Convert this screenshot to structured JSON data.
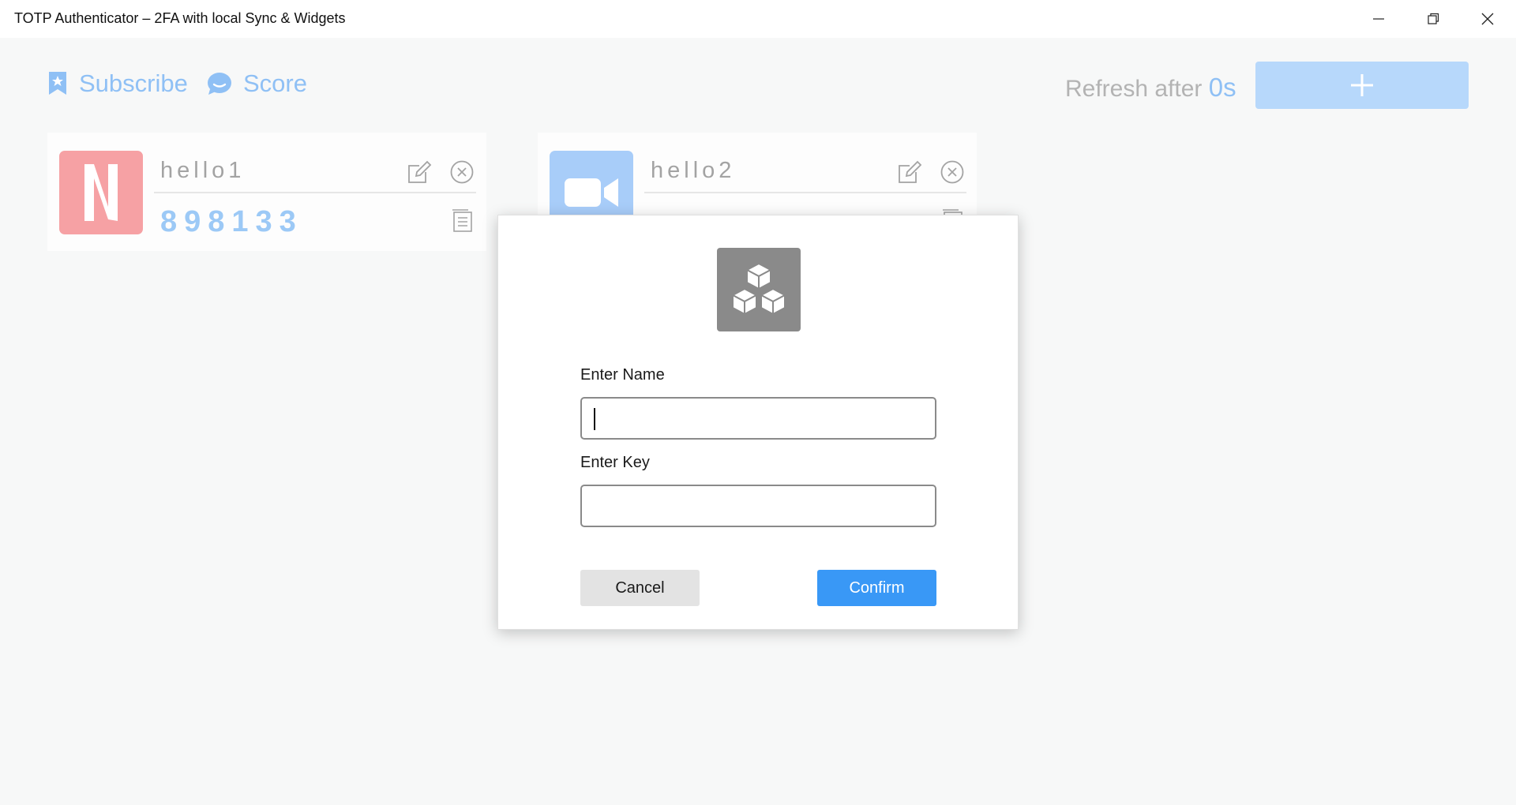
{
  "window": {
    "title": "TOTP Authenticator – 2FA with local Sync & Widgets"
  },
  "topbar": {
    "subscribe_label": "Subscribe",
    "subscribe_icon": "bookmark-star-icon",
    "score_label": "Score",
    "score_icon": "chat-bubble-icon",
    "refresh_label": "Refresh after ",
    "refresh_value": "0s",
    "add_icon": "plus-icon"
  },
  "accounts": [
    {
      "name": "hello1",
      "code": "898133",
      "logo": "netflix-logo-icon",
      "logo_color": "#f6a1a4"
    },
    {
      "name": "hello2",
      "code": "",
      "logo": "video-camera-icon",
      "logo_color": "#a8cdf9"
    }
  ],
  "dialog": {
    "icon": "cubes-icon",
    "name_label": "Enter Name",
    "name_value": "",
    "key_label": "Enter Key",
    "key_value": "",
    "cancel_label": "Cancel",
    "confirm_label": "Confirm"
  },
  "colors": {
    "accent": "#3998f6",
    "accent_light": "#8fc0f5",
    "add_button": "#b7d8fb"
  }
}
